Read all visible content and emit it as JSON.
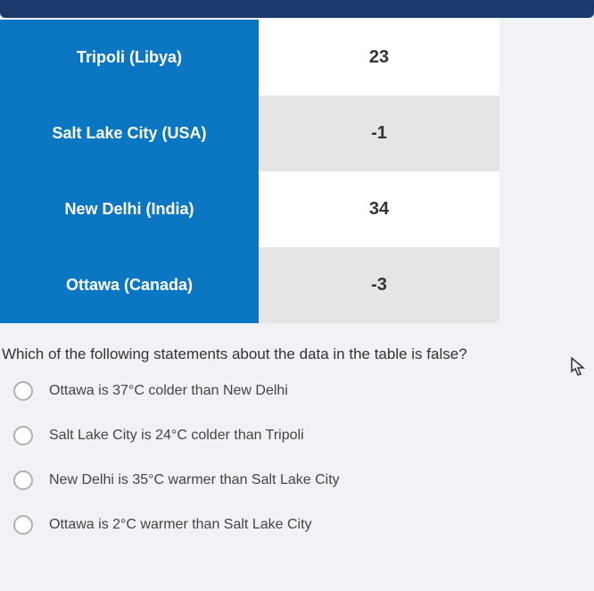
{
  "table": {
    "rows": [
      {
        "city": "Tripoli (Libya)",
        "value": "23"
      },
      {
        "city": "Salt Lake City (USA)",
        "value": "-1"
      },
      {
        "city": "New Delhi (India)",
        "value": "34"
      },
      {
        "city": "Ottawa (Canada)",
        "value": "-3"
      }
    ]
  },
  "question": "Which of the following statements about the data in the table is false?",
  "options": [
    "Ottawa is 37°C colder than New Delhi",
    "Salt Lake City is 24°C colder than Tripoli",
    "New Delhi is 35°C warmer than Salt Lake City",
    "Ottawa is 2°C warmer than Salt Lake City"
  ]
}
